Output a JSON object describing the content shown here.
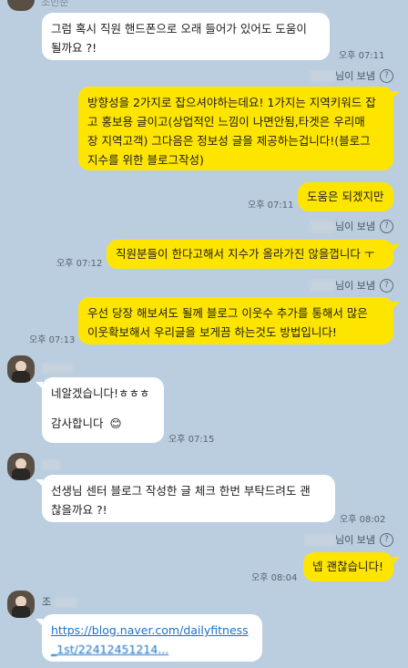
{
  "top": {
    "name_fragment": "조민준",
    "msg1": [
      "그럼 혹시 직원 핸드폰으로 오래 들어가 있어도 도움이",
      "될까요 ?!"
    ],
    "time1": "오후 07:11"
  },
  "sender_suffix": "님이 보냄",
  "help_icon": "?",
  "mine1": {
    "lines": [
      "방향성을 2가지로 잡으셔야하는데요! 1가지는 지역키워드 잡",
      "고 홍보용 글이고(상업적인 느낌이 나면안됨,타겟은 우리매",
      "장 지역고객) 그다음은 정보성 글을 제공하는겁니다!(블로그",
      "지수를 위한 블로그작성)"
    ]
  },
  "mine2": {
    "text": "도움은 되겠지만",
    "time": "오후 07:11"
  },
  "mine3": {
    "text": "직원분들이 한다고해서 지수가 올라가진 않을껍니다 ㅜ",
    "time": "오후 07:12"
  },
  "mine4": {
    "lines": [
      "우선 당장 해보셔도 될께 블로그 이웃수 추가를 통해서 많은",
      "이웃확보해서 우리글을 보게끔 하는것도 방법입니다!"
    ],
    "time": "오후 07:13"
  },
  "theirs2": {
    "line1": "네알겠습니다!ㅎㅎㅎ",
    "line2": "감사합니다",
    "emoji": "😊",
    "time": "오후 07:15"
  },
  "theirs3": {
    "lines": [
      "선생님 센터 블로그 작성한 글 체크 한번 부탁드려도 괜",
      "찮을까요 ?!"
    ],
    "time": "오후 08:02"
  },
  "mine5": {
    "text": "넵 괜찮습니다!",
    "time": "오후 08:04"
  },
  "theirs4": {
    "name_initial": "조",
    "link_line1": "https://blog.naver.com/dailyfitness",
    "link_line2": "_1st/22412451214..."
  }
}
